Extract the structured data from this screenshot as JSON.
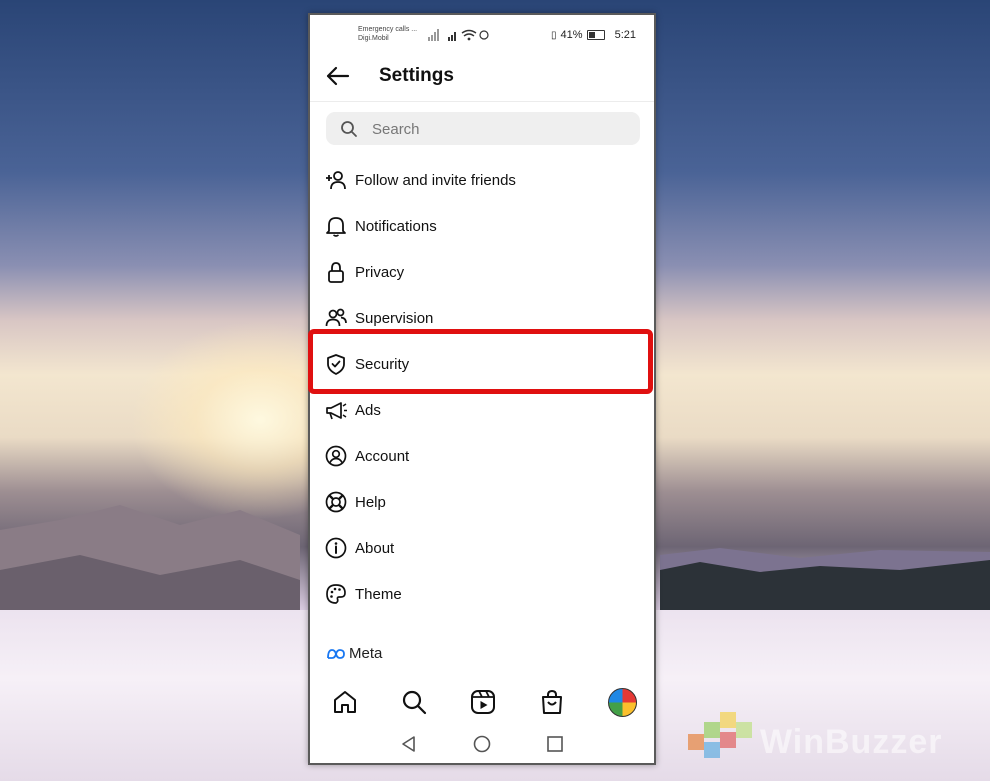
{
  "status_bar": {
    "carrier_line1": "Emergency calls ...",
    "carrier_line2": "Digi.Mobil",
    "battery_percent": "41%",
    "time": "5:21"
  },
  "header": {
    "title": "Settings"
  },
  "search": {
    "placeholder": "Search"
  },
  "menu": {
    "items": [
      {
        "label": "Follow and invite friends",
        "icon": "add-person-icon"
      },
      {
        "label": "Notifications",
        "icon": "bell-icon"
      },
      {
        "label": "Privacy",
        "icon": "lock-icon"
      },
      {
        "label": "Supervision",
        "icon": "people-icon"
      },
      {
        "label": "Security",
        "icon": "shield-icon",
        "highlighted": true
      },
      {
        "label": "Ads",
        "icon": "megaphone-icon"
      },
      {
        "label": "Account",
        "icon": "account-circle-icon"
      },
      {
        "label": "Help",
        "icon": "lifebuoy-icon"
      },
      {
        "label": "About",
        "icon": "info-icon"
      },
      {
        "label": "Theme",
        "icon": "palette-icon"
      }
    ]
  },
  "footer": {
    "brand": "Meta"
  },
  "bottom_nav": [
    "home-icon",
    "search-icon",
    "reels-icon",
    "shop-icon",
    "profile-avatar"
  ],
  "system_nav": [
    "back-triangle-icon",
    "home-circle-icon",
    "recents-square-icon"
  ],
  "watermark": {
    "text": "WinBuzzer"
  },
  "colors": {
    "highlight": "#e01010",
    "text": "#111111",
    "search_bg": "#efefef"
  }
}
